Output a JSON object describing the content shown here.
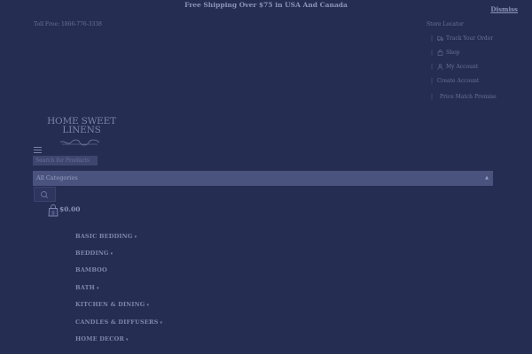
{
  "promo_bar": {
    "text": "Free Shipping Over $75 in USA And Canada",
    "dismiss_label": "Dismiss"
  },
  "top_bar": {
    "toll_free": "Toll Free: 1866-776-3338",
    "store_locator": "Store Locator"
  },
  "account_links": [
    {
      "label": "Track Your Order",
      "icon": "truck-icon",
      "separator": "|"
    },
    {
      "label": "Shop",
      "icon": "bag-icon",
      "separator": "|"
    },
    {
      "label": "My Account",
      "icon": "user-icon",
      "separator": "|"
    },
    {
      "label": "Create Account",
      "icon": "",
      "separator": "|"
    },
    {
      "label": "Price Match Promise",
      "icon": "",
      "separator": "|"
    }
  ],
  "logo": {
    "line1": "HOME SWEET",
    "line2": "LINENS"
  },
  "search": {
    "placeholder": "Search for Products",
    "category_selected": "All Categories",
    "button_icon": "search-icon"
  },
  "cart": {
    "count": "0",
    "total": "$0.00",
    "icon": "shopping-bag-icon"
  },
  "nav": [
    {
      "label": "BASIC BEDDING",
      "has_dropdown": true
    },
    {
      "label": "BEDDING",
      "has_dropdown": true
    },
    {
      "label": "BAMBOO",
      "has_dropdown": false
    },
    {
      "label": "BATH",
      "has_dropdown": true
    },
    {
      "label": "KITCHEN & DINING",
      "has_dropdown": true
    },
    {
      "label": "CANDLES & DIFFUSERS",
      "has_dropdown": true
    },
    {
      "label": "HOME DECOR",
      "has_dropdown": true
    }
  ],
  "colors": {
    "overlay": "#252d52",
    "text": "#8c93b8",
    "muted_text": "#6c7398",
    "search_bar": "#4a537e"
  }
}
